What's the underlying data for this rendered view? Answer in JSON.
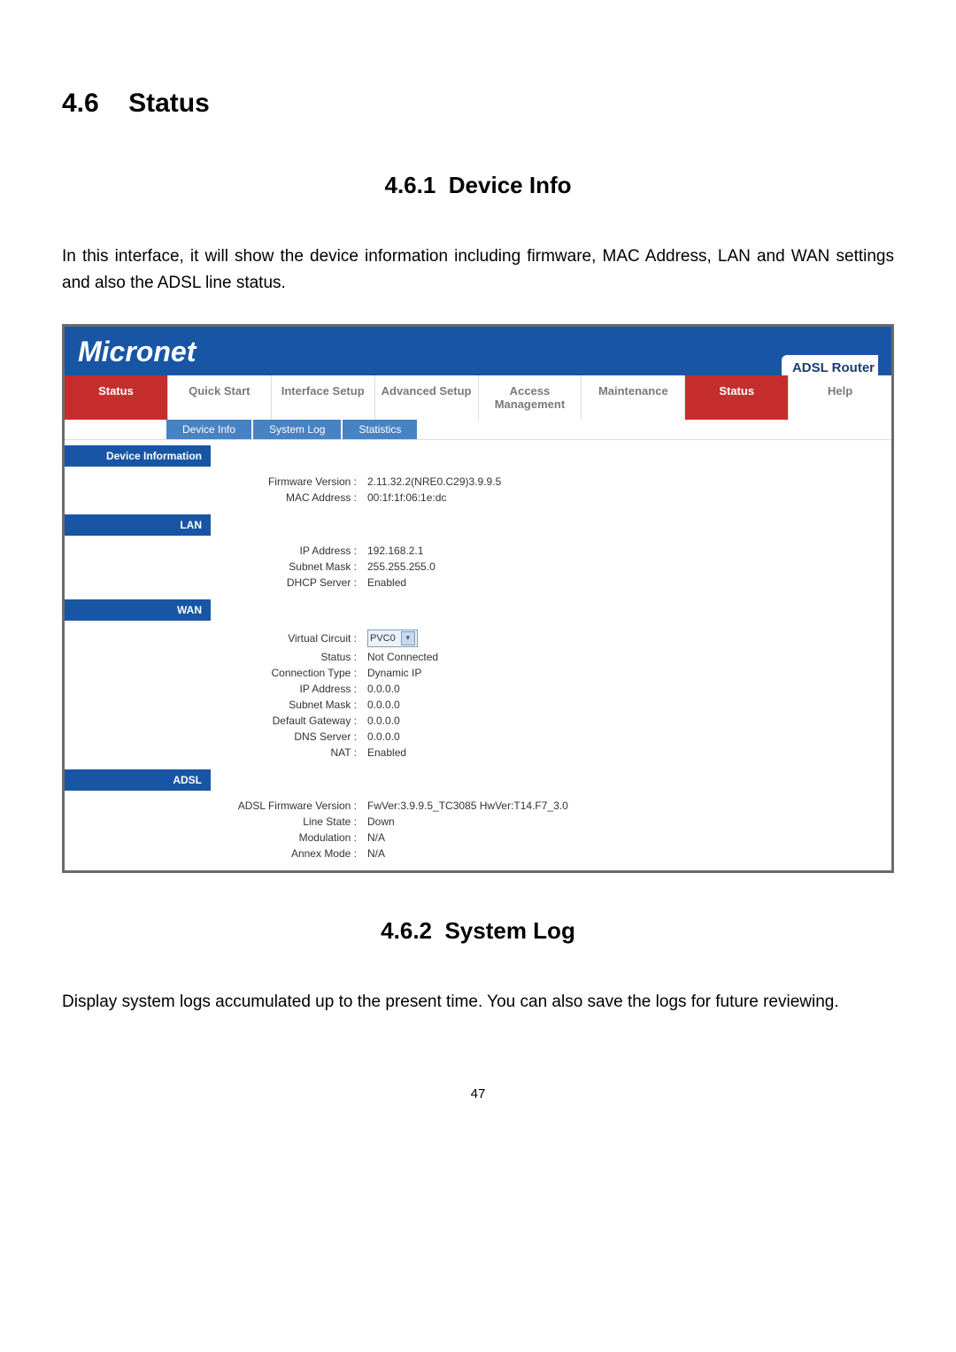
{
  "section": {
    "number": "4.6",
    "title": "Status"
  },
  "sub1": {
    "number": "4.6.1",
    "title": "Device Info"
  },
  "intro1": "In this interface, it will show the device information including firmware, MAC Address, LAN and WAN settings and also the ADSL line status.",
  "sub2": {
    "number": "4.6.2",
    "title": "System Log"
  },
  "intro2": "Display system logs accumulated up to the present time. You can also save the logs for future reviewing.",
  "page_number": "47",
  "router": {
    "brand": "Micronet",
    "brand_right": "ADSL Router",
    "tabs": [
      "Status",
      "Quick Start",
      "Interface Setup",
      "Advanced Setup",
      "Access Management",
      "Maintenance",
      "Status",
      "Help"
    ],
    "subtabs": [
      "Device Info",
      "System Log",
      "Statistics"
    ],
    "sections": {
      "device_info": {
        "header": "Device Information",
        "rows": [
          {
            "label": "Firmware Version :",
            "value": "2.11.32.2(NRE0.C29)3.9.9.5"
          },
          {
            "label": "MAC Address :",
            "value": "00:1f:1f:06:1e:dc"
          }
        ]
      },
      "lan": {
        "header": "LAN",
        "rows": [
          {
            "label": "IP Address :",
            "value": "192.168.2.1"
          },
          {
            "label": "Subnet Mask :",
            "value": "255.255.255.0"
          },
          {
            "label": "DHCP Server :",
            "value": "Enabled"
          }
        ]
      },
      "wan": {
        "header": "WAN",
        "vc_label": "Virtual Circuit :",
        "vc_value": "PVC0",
        "rows": [
          {
            "label": "Status :",
            "value": "Not Connected"
          },
          {
            "label": "Connection Type :",
            "value": "Dynamic IP"
          },
          {
            "label": "IP Address :",
            "value": "0.0.0.0"
          },
          {
            "label": "Subnet Mask :",
            "value": "0.0.0.0"
          },
          {
            "label": "Default Gateway :",
            "value": "0.0.0.0"
          },
          {
            "label": "DNS Server :",
            "value": "0.0.0.0"
          },
          {
            "label": "NAT :",
            "value": "Enabled"
          }
        ]
      },
      "adsl": {
        "header": "ADSL",
        "rows": [
          {
            "label": "ADSL Firmware Version :",
            "value": "FwVer:3.9.9.5_TC3085 HwVer:T14.F7_3.0"
          },
          {
            "label": "Line State :",
            "value": "Down"
          },
          {
            "label": "Modulation :",
            "value": "N/A"
          },
          {
            "label": "Annex Mode :",
            "value": "N/A"
          }
        ]
      }
    }
  }
}
